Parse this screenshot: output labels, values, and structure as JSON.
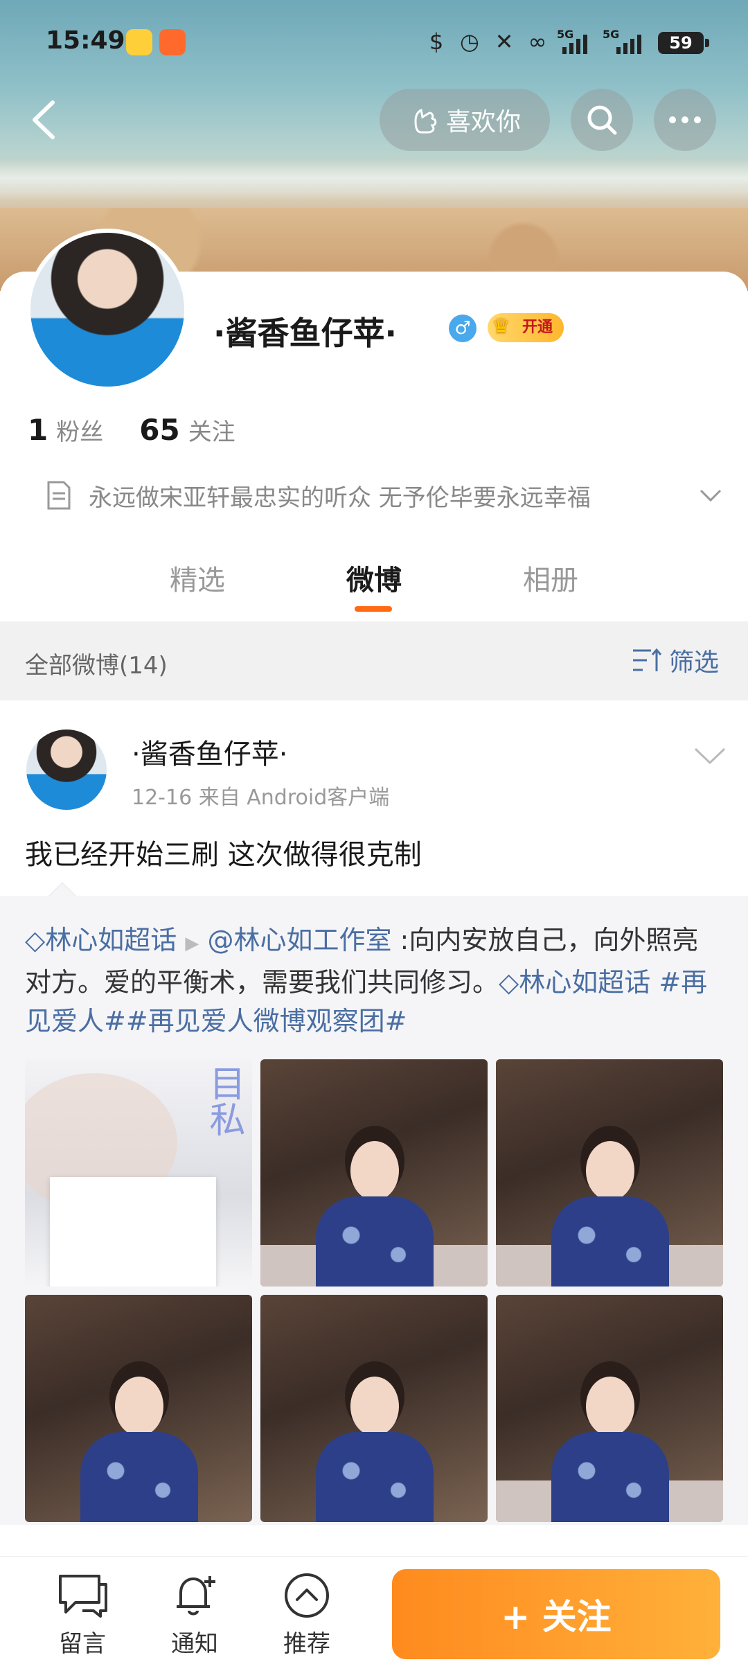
{
  "statusbar": {
    "time": "15:49",
    "signal_label_1": "5G",
    "signal_label_2": "5G",
    "battery": "59"
  },
  "header": {
    "like_you_label": "喜欢你",
    "icons": [
      "back-arrow-icon",
      "like-hand-icon",
      "search-icon",
      "more-icon"
    ]
  },
  "profile": {
    "nickname": "·酱香鱼仔苹·",
    "gender_symbol": "♂",
    "vip_label": "开通",
    "followers_count": "1",
    "followers_label": "粉丝",
    "following_count": "65",
    "following_label": "关注",
    "bio": "永远做宋亚轩最忠实的听众 无予伦毕要永远幸福"
  },
  "tabs": [
    {
      "label": "精选"
    },
    {
      "label": "微博"
    },
    {
      "label": "相册"
    }
  ],
  "filter": {
    "title": "全部微博(14)",
    "button": "筛选"
  },
  "post": {
    "author": "·酱香鱼仔苹·",
    "meta": "12-16   来自 Android客户端",
    "text": "我已经开始三刷 这次做得很克制",
    "repost": {
      "tag1": "林心如超话",
      "mention": "@林心如工作室",
      "body": " :向内安放自己，向外照亮对方。爱的平衡术，需要我们共同修习。",
      "tag2": "林心如超话",
      "hashtags": " #再见爱人##再见爱人微博观察团#",
      "photo_title_art": "目私"
    }
  },
  "bottombar": {
    "comment_label": "留言",
    "notify_label": "通知",
    "recommend_label": "推荐",
    "follow_label": "+ 关注"
  },
  "colors": {
    "accent": "#ff6a13",
    "link": "#4a6ea3",
    "follow_button": "#ff9a26"
  }
}
